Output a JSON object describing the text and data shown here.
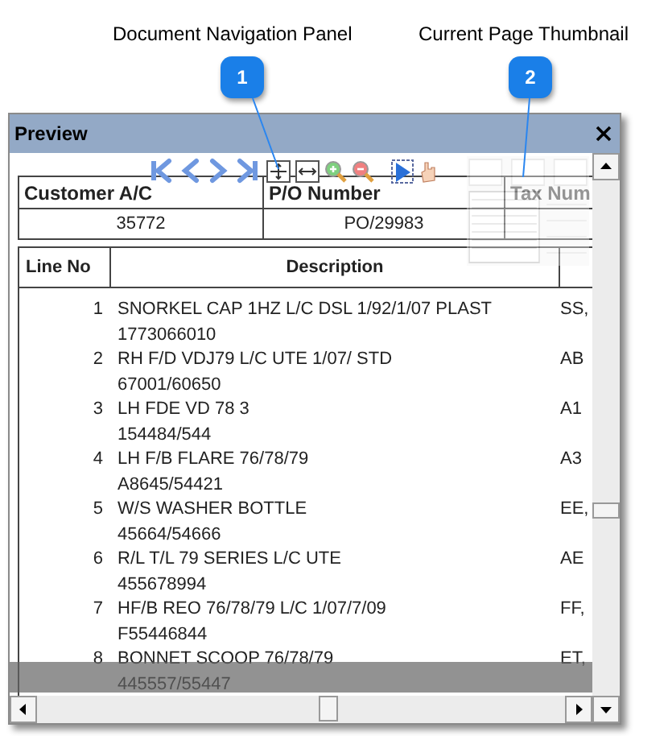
{
  "callouts": [
    {
      "number": "1",
      "label": "Document Navigation Panel"
    },
    {
      "number": "2",
      "label": "Current Page Thumbnail"
    }
  ],
  "window": {
    "title": "Preview"
  },
  "document": {
    "header_columns": [
      "Customer A/C",
      "P/O Number",
      "Tax Num"
    ],
    "header_values": [
      "35772",
      "PO/29983"
    ],
    "line_columns": [
      "Line No",
      "Description"
    ],
    "lines": [
      {
        "no": "1",
        "description": "SNORKEL CAP 1HZ L/C DSL 1/92/1/07 PLAST",
        "code": "1773066010",
        "column_3": "SS,"
      },
      {
        "no": "2",
        "description": "RH F/D VDJ79 L/C UTE 1/07/ STD",
        "code": "67001/60650",
        "column_3": "AB"
      },
      {
        "no": "3",
        "description": "LH FDE VD 78 3",
        "code": "154484/544",
        "column_3": "A1"
      },
      {
        "no": "4",
        "description": "LH F/B FLARE 76/78/79",
        "code": "A8645/54421",
        "column_3": "A3"
      },
      {
        "no": "5",
        "description": "W/S WASHER BOTTLE",
        "code": "45664/54666",
        "column_3": "EE,"
      },
      {
        "no": "6",
        "description": "R/L T/L 79 SERIES L/C UTE",
        "code": "455678994",
        "column_3": "AE"
      },
      {
        "no": "7",
        "description": "HF/B REO 76/78/79 L/C 1/07/7/09",
        "code": "F55446844",
        "column_3": "FF,"
      },
      {
        "no": "8",
        "description": "BONNET SCOOP 76/78/79",
        "code": "445557/55447",
        "column_3": "ET,"
      }
    ]
  }
}
